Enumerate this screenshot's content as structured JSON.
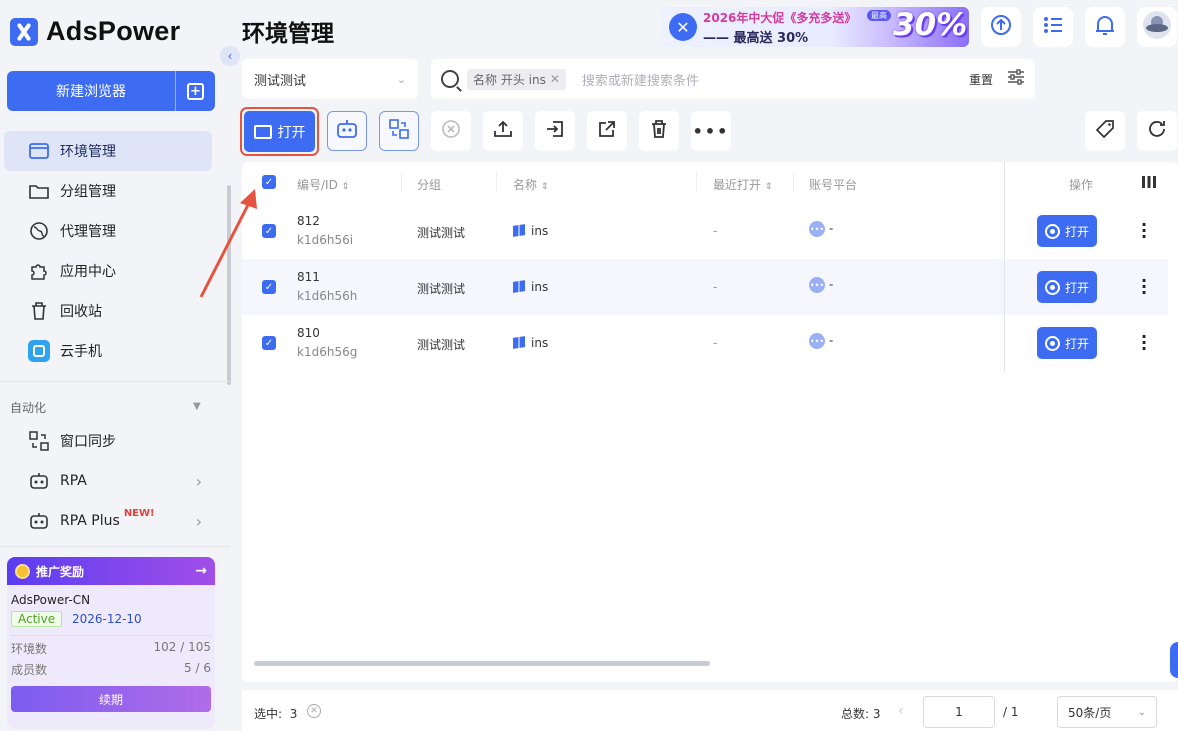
{
  "app": {
    "name": "AdsPower"
  },
  "sidebar": {
    "new_browser": "新建浏览器",
    "items": [
      {
        "label": "环境管理",
        "active": true
      },
      {
        "label": "分组管理"
      },
      {
        "label": "代理管理"
      },
      {
        "label": "应用中心"
      },
      {
        "label": "回收站"
      },
      {
        "label": "云手机"
      }
    ],
    "automation_label": "自动化",
    "automation_items": [
      {
        "label": "窗口同步"
      },
      {
        "label": "RPA"
      },
      {
        "label": "RPA Plus",
        "tag": "NEW!"
      }
    ],
    "promo": {
      "title": "推广奖励",
      "account": "AdsPower-CN",
      "status": "Active",
      "expiry": "2026-12-10",
      "env_label": "环境数",
      "env_value": "102 / 105",
      "members_label": "成员数",
      "members_value": "5 / 6",
      "renew": "续期"
    }
  },
  "header": {
    "title": "环境管理",
    "banner": {
      "line1": "2026年中大促《多充多送》",
      "line2": "—— 最高送 30%",
      "pill": "最高",
      "big": "30%"
    }
  },
  "filter": {
    "group": "测试测试",
    "chip": "名称 开头 ins",
    "placeholder": "搜索或新建搜索条件",
    "reset": "重置"
  },
  "toolbar": {
    "open": "打开"
  },
  "table": {
    "headers": {
      "id": "编号/ID",
      "group": "分组",
      "name": "名称",
      "last_open": "最近打开",
      "platform": "账号平台",
      "ops": "操作"
    },
    "rows": [
      {
        "num": "812",
        "id": "k1d6h56i",
        "group": "测试测试",
        "name": "ins",
        "last_open": "-",
        "platform": "-",
        "action": "打开"
      },
      {
        "num": "811",
        "id": "k1d6h56h",
        "group": "测试测试",
        "name": "ins",
        "last_open": "-",
        "platform": "-",
        "action": "打开"
      },
      {
        "num": "810",
        "id": "k1d6h56g",
        "group": "测试测试",
        "name": "ins",
        "last_open": "-",
        "platform": "-",
        "action": "打开"
      }
    ]
  },
  "footer": {
    "selected_label": "选中:",
    "selected_count": "3",
    "total": "总数: 3",
    "page": "1",
    "of": "/ 1",
    "page_size": "50条/页"
  },
  "colors": {
    "accent": "#3d6cf2",
    "highlight": "#e5543e"
  }
}
